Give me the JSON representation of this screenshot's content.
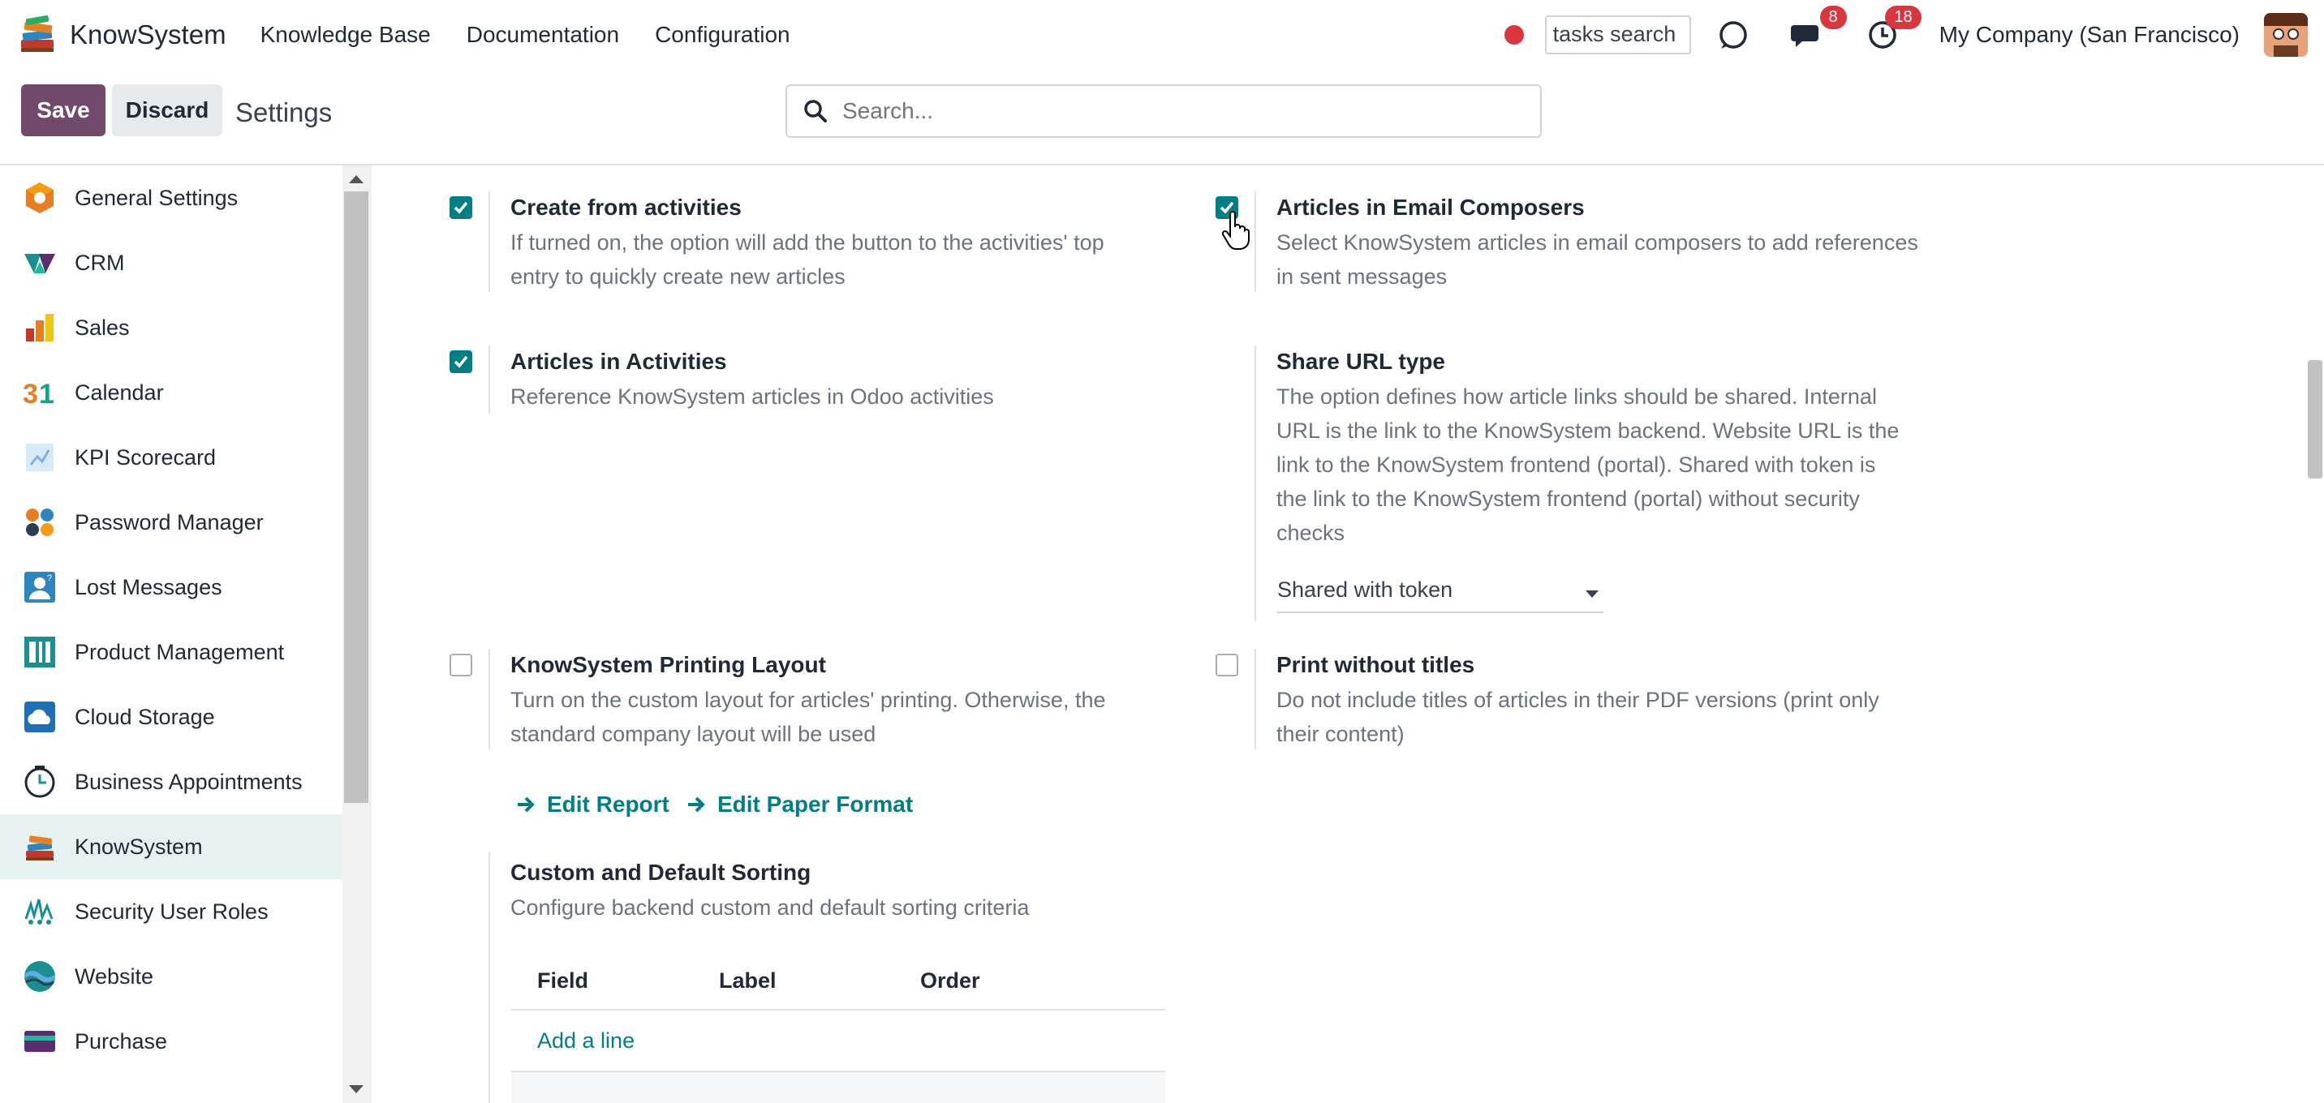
{
  "navbar": {
    "brand": "KnowSystem",
    "menu": [
      "Knowledge Base",
      "Documentation",
      "Configuration"
    ],
    "tasks_search": "tasks search",
    "messages_badge": "8",
    "activities_badge": "18",
    "company": "My Company (San Francisco)"
  },
  "control_panel": {
    "save_label": "Save",
    "discard_label": "Discard",
    "title": "Settings",
    "search_placeholder": "Search..."
  },
  "sidebar": {
    "items": [
      {
        "label": "General Settings",
        "icon": "general-settings-icon"
      },
      {
        "label": "CRM",
        "icon": "crm-icon"
      },
      {
        "label": "Sales",
        "icon": "sales-icon"
      },
      {
        "label": "Calendar",
        "icon": "calendar-icon"
      },
      {
        "label": "KPI Scorecard",
        "icon": "kpi-scorecard-icon"
      },
      {
        "label": "Password Manager",
        "icon": "password-manager-icon"
      },
      {
        "label": "Lost Messages",
        "icon": "lost-messages-icon"
      },
      {
        "label": "Product Management",
        "icon": "product-management-icon"
      },
      {
        "label": "Cloud Storage",
        "icon": "cloud-storage-icon"
      },
      {
        "label": "Business Appointments",
        "icon": "business-appointments-icon"
      },
      {
        "label": "KnowSystem",
        "icon": "knowsystem-icon",
        "active": true
      },
      {
        "label": "Security User Roles",
        "icon": "security-user-roles-icon"
      },
      {
        "label": "Website",
        "icon": "website-icon"
      },
      {
        "label": "Purchase",
        "icon": "purchase-icon"
      }
    ]
  },
  "settings": {
    "create_from_activities": {
      "title": "Create from activities",
      "desc_1": "If turned on, the option will add the button to the activities' top",
      "desc_2": "entry to quickly create new articles",
      "checked": true
    },
    "articles_in_email": {
      "title": "Articles in Email Composers",
      "desc_1": "Select KnowSystem articles in email composers to add references",
      "desc_2": "in sent messages",
      "checked": true
    },
    "articles_in_activities": {
      "title": "Articles in Activities",
      "desc_1": "Reference KnowSystem articles in Odoo activities",
      "checked": true
    },
    "share_url_type": {
      "title": "Share URL type",
      "desc_1": "The option defines how article links should be shared. Internal",
      "desc_2": "URL is the link to the KnowSystem backend. Website URL is the",
      "desc_3": "link to the KnowSystem frontend (portal). Shared with token is",
      "desc_4": "the link to the KnowSystem frontend (portal) without security",
      "desc_5": "checks",
      "value": "Shared with token"
    },
    "printing_layout": {
      "title": "KnowSystem Printing Layout",
      "desc_1": "Turn on the custom layout for articles' printing. Otherwise, the",
      "desc_2": "standard company layout will be used",
      "checked": false,
      "edit_report": "Edit Report",
      "edit_paper_format": "Edit Paper Format"
    },
    "print_without_titles": {
      "title": "Print without titles",
      "desc_1": "Do not include titles of articles in their PDF versions (print only",
      "desc_2": "their content)",
      "checked": false
    },
    "sorting": {
      "title": "Custom and Default Sorting",
      "desc_1": "Configure backend custom and default sorting criteria",
      "columns": [
        "Field",
        "Label",
        "Order"
      ],
      "add_line": "Add a line"
    }
  },
  "colors": {
    "primary": "#71496a",
    "accent": "#017e84",
    "badge": "#d9363e"
  }
}
